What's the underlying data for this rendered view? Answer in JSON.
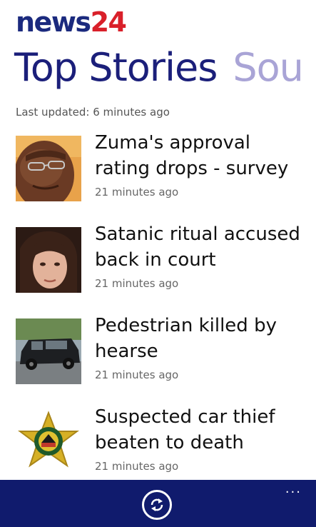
{
  "header": {
    "logo_part1": "news",
    "logo_part2": "24",
    "pivot_active": "Top Stories",
    "pivot_next": "Sou",
    "last_updated": "Last updated: 6 minutes ago"
  },
  "stories": [
    {
      "title_line1": "Zuma's approval",
      "title_line2": "rating drops - survey",
      "time": "21 minutes ago",
      "thumb": "man-portrait"
    },
    {
      "title_line1": "Satanic ritual accused",
      "title_line2": "back in court",
      "time": "21 minutes ago",
      "thumb": "woman-portrait"
    },
    {
      "title_line1": "Pedestrian killed by",
      "title_line2": "hearse",
      "time": "21 minutes ago",
      "thumb": "hearse-car"
    },
    {
      "title_line1": "Suspected car thief",
      "title_line2": "beaten to death",
      "time": "21 minutes ago",
      "thumb": "police-badge"
    }
  ],
  "appbar": {
    "refresh_icon": "refresh-icon",
    "more_label": "..."
  },
  "colors": {
    "brand_blue": "#1b2a7e",
    "brand_red": "#d9202a",
    "appbar_bg": "#101b6d"
  }
}
